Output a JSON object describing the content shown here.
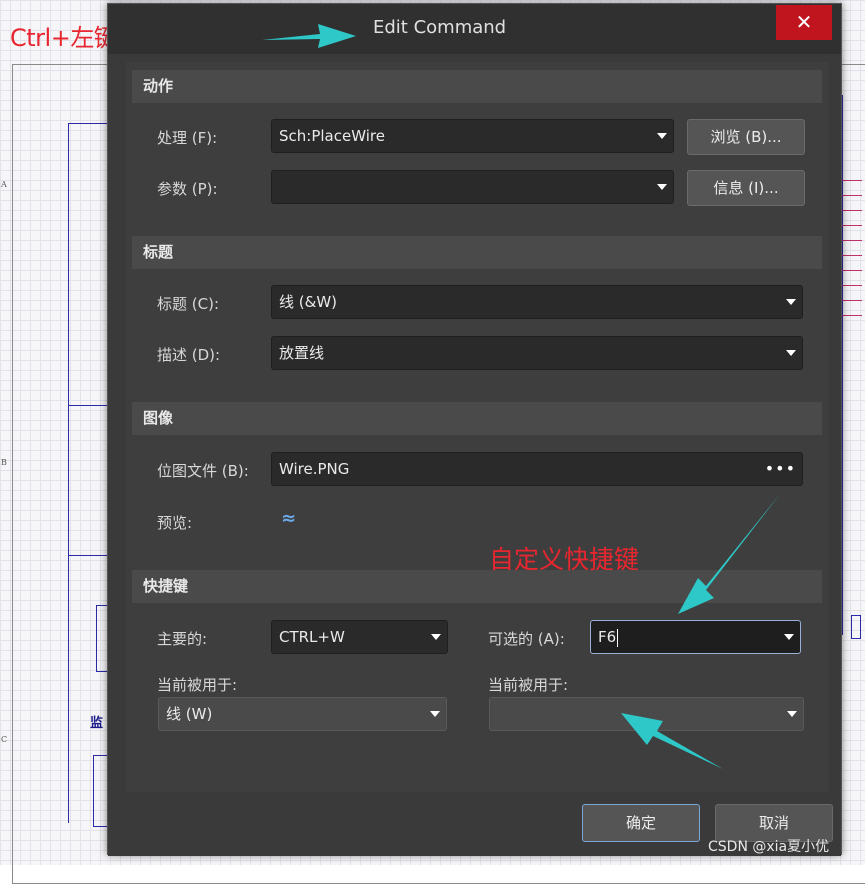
{
  "annotations": {
    "top_note": "Ctrl+左键单击命令",
    "custom_shortcut_note": "自定义快捷键",
    "arrow_color": "#2ec8c8",
    "note_color": "#e8262f"
  },
  "background": {
    "zone_letters": [
      "A",
      "B",
      "C"
    ],
    "schematic_label": "监"
  },
  "dialog": {
    "title": "Edit Command",
    "close_icon": "close-icon",
    "sections": {
      "action": {
        "header": "动作",
        "process_label": "处理 (F):",
        "process_value": "Sch:PlaceWire",
        "browse_button": "浏览 (B)...",
        "params_label": "参数 (P):",
        "params_value": "",
        "info_button": "信息 (I)..."
      },
      "caption": {
        "header": "标题",
        "title_label": "标题 (C):",
        "title_value": "线 (&W)",
        "desc_label": "描述 (D):",
        "desc_value": "放置线"
      },
      "image": {
        "header": "图像",
        "bitmap_label": "位图文件 (B):",
        "bitmap_value": "Wire.PNG",
        "browse_dots": "•••",
        "preview_label": "预览:",
        "preview_icon": "≈"
      },
      "shortcut": {
        "header": "快捷键",
        "primary_label": "主要的:",
        "primary_value": "CTRL+W",
        "alternative_label": "可选的 (A):",
        "alternative_value": "F6",
        "primary_used_by_label": "当前被用于:",
        "primary_used_by_value": "线 (W)",
        "alt_used_by_label": "当前被用于:",
        "alt_used_by_value": ""
      }
    },
    "buttons": {
      "ok": "确定",
      "cancel": "取消"
    }
  },
  "watermark": "CSDN @xia夏小优"
}
